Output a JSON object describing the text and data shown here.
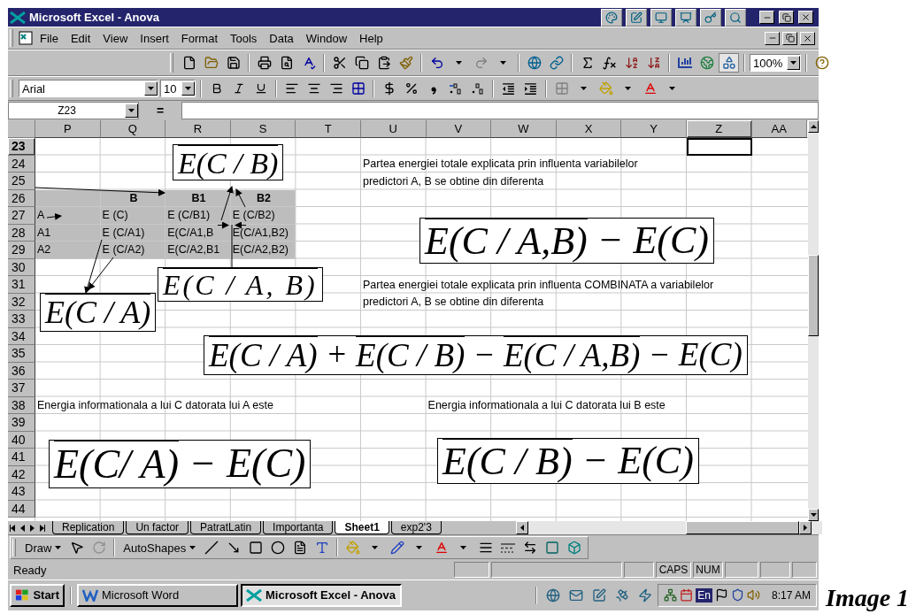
{
  "window": {
    "title": "Microsoft Excel - Anova"
  },
  "menu": [
    "File",
    "Edit",
    "View",
    "Insert",
    "Format",
    "Tools",
    "Data",
    "Window",
    "Help"
  ],
  "standard_toolbar": {
    "zoom": "100%"
  },
  "formatting_toolbar": {
    "font": "Arial",
    "size": "10"
  },
  "formula_bar": {
    "name_box": "Z23",
    "equals": "="
  },
  "sheet": {
    "columns": [
      {
        "label": "P",
        "selected": false
      },
      {
        "label": "Q",
        "selected": false
      },
      {
        "label": "R",
        "selected": false
      },
      {
        "label": "S",
        "selected": false
      },
      {
        "label": "T",
        "selected": false
      },
      {
        "label": "U",
        "selected": false
      },
      {
        "label": "V",
        "selected": false
      },
      {
        "label": "W",
        "selected": false
      },
      {
        "label": "X",
        "selected": false
      },
      {
        "label": "Y",
        "selected": false
      },
      {
        "label": "Z",
        "selected": true
      },
      {
        "label": "AA",
        "selected": false
      }
    ],
    "rows": [
      {
        "number": "23",
        "selected": true,
        "shaded": false
      },
      {
        "number": "24",
        "selected": false,
        "shaded": false,
        "cells": [
          null,
          null,
          null,
          null,
          null,
          {
            "text": "Partea energiei totale explicata prin influenta variabilelor",
            "bold": false
          }
        ]
      },
      {
        "number": "25",
        "selected": false,
        "shaded": false,
        "cells": [
          null,
          null,
          null,
          null,
          null,
          {
            "text": "predictori A, B se obtine din diferenta",
            "bold": false
          }
        ]
      },
      {
        "number": "26",
        "selected": false,
        "shaded": true,
        "cells": [
          null,
          {
            "text": "B",
            "bold": true
          },
          {
            "text": "B1",
            "bold": true
          },
          {
            "text": "B2",
            "bold": true
          }
        ]
      },
      {
        "number": "27",
        "selected": false,
        "shaded": true,
        "cells": [
          {
            "text": "A",
            "bold": false
          },
          {
            "text": "E (C)",
            "bold": false
          },
          {
            "text": "E (C/B1)",
            "bold": false
          },
          {
            "text": "E (C/B2)",
            "bold": false
          }
        ]
      },
      {
        "number": "28",
        "selected": false,
        "shaded": true,
        "cells": [
          {
            "text": "A1",
            "bold": false
          },
          {
            "text": "E (C/A1)",
            "bold": false
          },
          {
            "text": "E(C/A1,B",
            "bold": false
          },
          {
            "text": "E(C/A1,B2)",
            "bold": false
          }
        ]
      },
      {
        "number": "29",
        "selected": false,
        "shaded": true,
        "cells": [
          {
            "text": "A2",
            "bold": false
          },
          {
            "text": "E (C/A2)",
            "bold": false
          },
          {
            "text": "E(C/A2,B1",
            "bold": false
          },
          {
            "text": "E(C/A2,B2)",
            "bold": false
          }
        ]
      },
      {
        "number": "30",
        "selected": false,
        "shaded": false
      },
      {
        "number": "31",
        "selected": false,
        "shaded": false,
        "cells": [
          null,
          null,
          null,
          null,
          null,
          {
            "text": "Partea energiei totale explicata prin influenta COMBINATA a variabilelor",
            "bold": false
          }
        ]
      },
      {
        "number": "32",
        "selected": false,
        "shaded": false,
        "cells": [
          null,
          null,
          null,
          null,
          null,
          {
            "text": "predictori A, B se obtine din diferenta",
            "bold": false
          }
        ]
      },
      {
        "number": "33",
        "selected": false,
        "shaded": false
      },
      {
        "number": "34",
        "selected": false,
        "shaded": false
      },
      {
        "number": "35",
        "selected": false,
        "shaded": false
      },
      {
        "number": "36",
        "selected": false,
        "shaded": false
      },
      {
        "number": "37",
        "selected": false,
        "shaded": false
      },
      {
        "number": "38",
        "selected": false,
        "shaded": false,
        "cells": [
          {
            "text": "Energia informationala a lui C datorata lui A este",
            "bold": false
          },
          null,
          null,
          null,
          null,
          null,
          {
            "text": "Energia informationala a lui C datorata lui B este",
            "bold": false
          }
        ]
      },
      {
        "number": "39",
        "selected": false,
        "shaded": false
      },
      {
        "number": "40",
        "selected": false,
        "shaded": false
      },
      {
        "number": "41",
        "selected": false,
        "shaded": false
      },
      {
        "number": "42",
        "selected": false,
        "shaded": false
      },
      {
        "number": "43",
        "selected": false,
        "shaded": false
      },
      {
        "number": "44",
        "selected": false,
        "shaded": false
      }
    ],
    "formulas": [
      {
        "parts": [
          {
            "text": "E(C / B)",
            "overline": true
          }
        ]
      },
      {
        "parts": [
          {
            "text": "E(C / A, B)",
            "overline": true
          }
        ]
      },
      {
        "parts": [
          {
            "text": "E(C / A)",
            "overline": true
          }
        ]
      },
      {
        "parts": [
          {
            "text": "E(C / A,B)",
            "overline": true
          },
          {
            "text": " − E(C)",
            "overline": false
          }
        ]
      },
      {
        "parts": [
          {
            "text": "E(C / A)",
            "overline": true
          },
          {
            "text": " + ",
            "overline": false
          },
          {
            "text": "E(C / B)",
            "overline": true
          },
          {
            "text": " − ",
            "overline": false
          },
          {
            "text": "E(C / A,B)",
            "overline": true
          },
          {
            "text": " − E(C)",
            "overline": false
          }
        ]
      },
      {
        "parts": [
          {
            "text": "E(C/ A)",
            "overline": true
          },
          {
            "text": " − E(C)",
            "overline": false
          }
        ]
      },
      {
        "parts": [
          {
            "text": "E(C / B)",
            "overline": true
          },
          {
            "text": " − E(C)",
            "overline": false
          }
        ]
      }
    ]
  },
  "sheet_tabs": [
    {
      "label": "Replication",
      "selected": false
    },
    {
      "label": "Un factor",
      "selected": false
    },
    {
      "label": "PatratLatin",
      "selected": false
    },
    {
      "label": "Importanta",
      "selected": false
    },
    {
      "label": "Sheet1",
      "selected": true
    },
    {
      "label": "exp2'3",
      "selected": false
    }
  ],
  "drawing_toolbar": {
    "draw": "Draw",
    "autoshapes": "AutoShapes"
  },
  "status_bar": {
    "text": "Ready",
    "indicators": [
      "CAPS",
      "NUM"
    ]
  },
  "taskbar": {
    "start": "Start",
    "buttons": [
      {
        "label": "Microsoft Word",
        "selected": false
      },
      {
        "label": "Microsoft Excel - Anova",
        "selected": true
      }
    ],
    "language": "En",
    "clock": "8:17 AM"
  },
  "caption": "Image 1"
}
